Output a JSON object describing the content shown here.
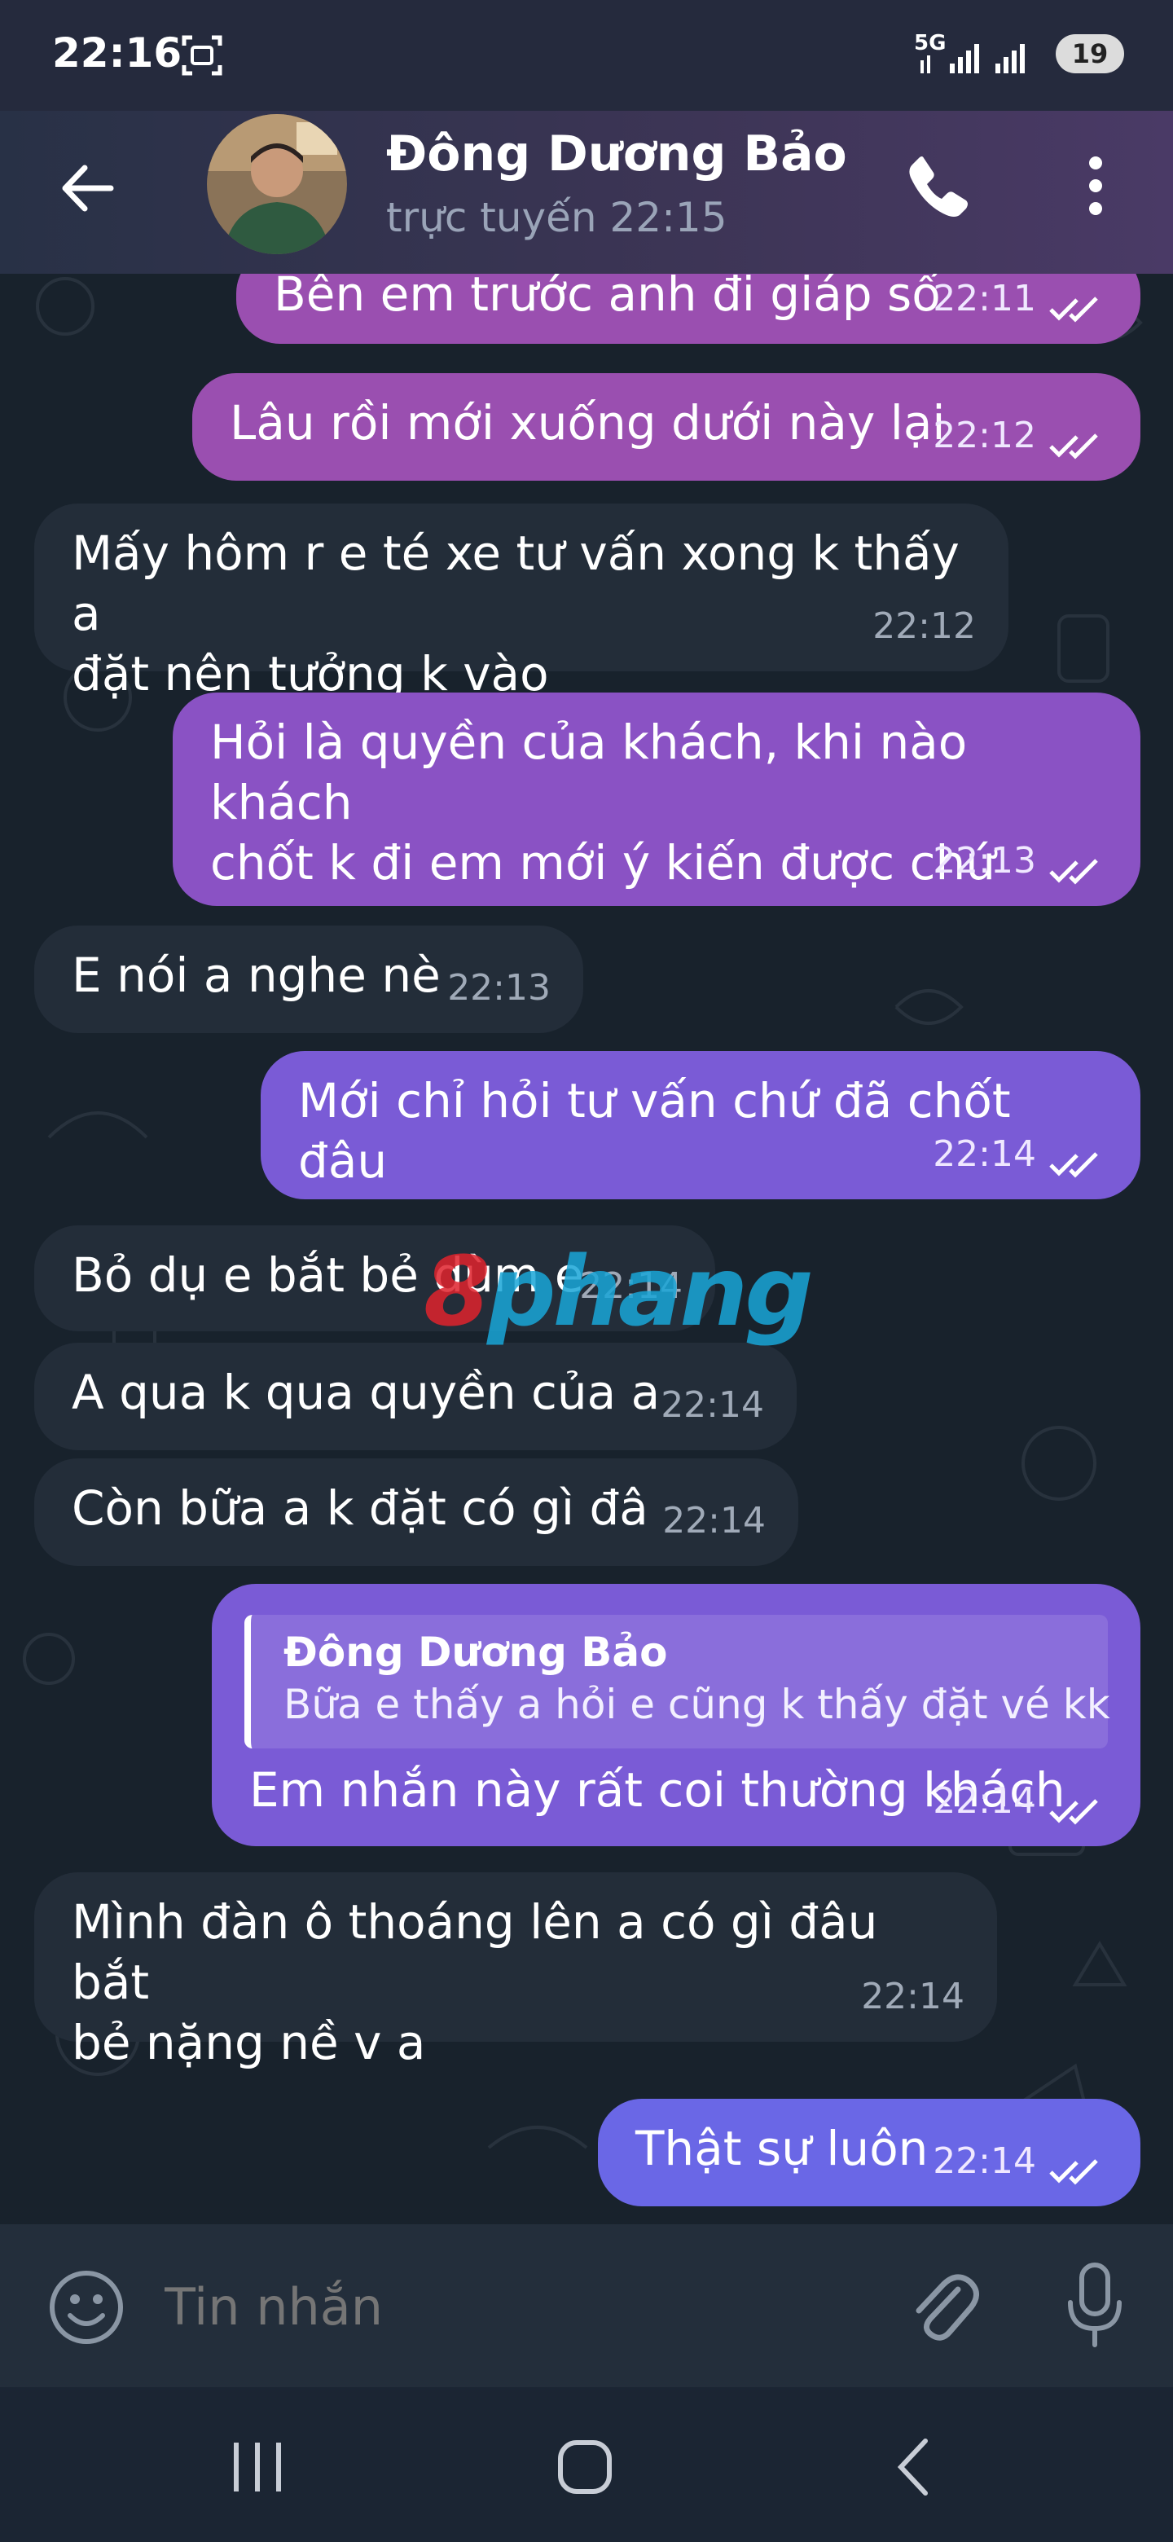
{
  "status_bar": {
    "time": "22:16",
    "network": "5G",
    "battery": "19"
  },
  "header": {
    "contact_name": "Đông Dương Bảo",
    "contact_status": "trực tuyến 22:15"
  },
  "messages": [
    {
      "direction": "out",
      "text": "Bên em trước anh đi giáp số",
      "time": "22:11",
      "read": true
    },
    {
      "direction": "out",
      "text": "Lâu rồi mới xuống dưới này lại",
      "time": "22:12",
      "read": true
    },
    {
      "direction": "in",
      "lines": [
        "Mấy hôm r e té xe tư vấn xong k thấy a",
        "đặt nên tưởng k vào"
      ],
      "time": "22:12"
    },
    {
      "direction": "out",
      "lines": [
        "Hỏi là quyền của khách, khi nào khách",
        "chốt k đi em mới ý kiến được chứ"
      ],
      "time": "22:13",
      "read": true
    },
    {
      "direction": "in",
      "text": "E nói a nghe nè",
      "time": "22:13"
    },
    {
      "direction": "out",
      "text": "Mới chỉ hỏi tư vấn chứ đã chốt đâu",
      "time": "22:14",
      "read": true
    },
    {
      "direction": "in",
      "text": "Bỏ dụ e bắt bẻ dùm e",
      "time": "22:14"
    },
    {
      "direction": "in",
      "text": "A qua k qua quyền của a",
      "time": "22:14"
    },
    {
      "direction": "in",
      "text": "Còn bữa a k đặt có gì đâ",
      "time": "22:14"
    },
    {
      "direction": "out",
      "reply_to": {
        "name": "Đông Dương Bảo",
        "text": "Bữa e thấy a hỏi e cũng k thấy đặt vé kk"
      },
      "text": "Em nhắn này rất coi thường khách",
      "time": "22:14",
      "read": true
    },
    {
      "direction": "in",
      "lines": [
        "Mình đàn ô thoáng lên a có gì đâu bắt",
        "bẻ nặng nề v a"
      ],
      "time": "22:14"
    },
    {
      "direction": "out",
      "text": "Thật sự luôn",
      "time": "22:14",
      "read": true
    }
  ],
  "watermark": {
    "part1": "8",
    "part2": "phang"
  },
  "composer": {
    "placeholder": "Tin nhắn"
  },
  "icons": [
    "back-arrow-icon",
    "phone-icon",
    "more-vertical-icon",
    "emoji-icon",
    "attach-icon",
    "mic-icon",
    "double-check-icon",
    "nav-recents-icon",
    "nav-home-icon",
    "nav-back-icon"
  ],
  "colors": {
    "header": "#3d3556",
    "chat_background": "#18222c",
    "incoming_bubble": "#232d39",
    "outgoing_gradient": [
      "#9a4fb0",
      "#8a52c4",
      "#7a5bd6",
      "#6a67e6"
    ]
  }
}
